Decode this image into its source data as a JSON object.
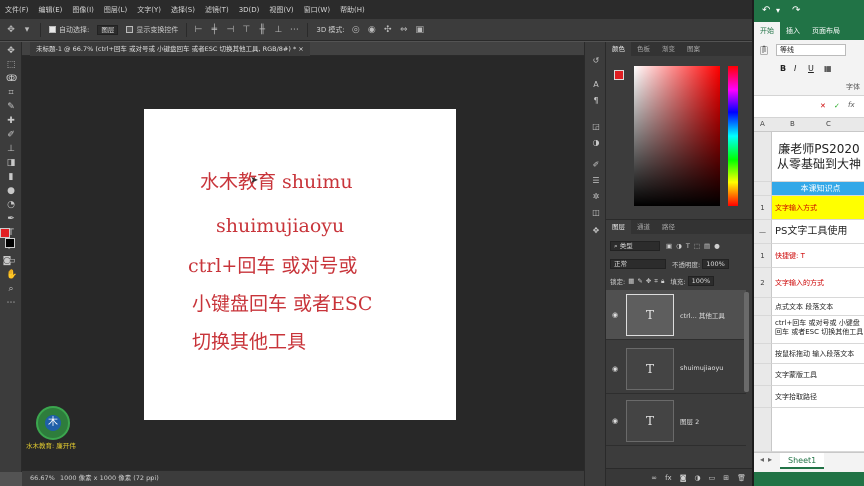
{
  "menu": [
    "文件(F)",
    "编辑(E)",
    "图像(I)",
    "图层(L)",
    "文字(Y)",
    "选择(S)",
    "滤镜(T)",
    "3D(D)",
    "视图(V)",
    "窗口(W)",
    "帮助(H)"
  ],
  "options": {
    "auto_select_label": "自动选择:",
    "auto_select_value": "图层",
    "show_transform_label": "显示变换控件",
    "mode_3d_label": "3D 模式:"
  },
  "document_tab": "未标题-1 @ 66.7% (ctrl+回车 或对号或 小键盘回车 或者ESC  切换其他工具, RGB/8#) *",
  "canvas_text": {
    "line1": "水木教育 shuimu",
    "line2": "shuimujiaoyu",
    "line3": "ctrl+回车 或对号或",
    "line4": "小键盘回车 或者ESC",
    "line5": "切换其他工具"
  },
  "watermark": {
    "logo_char": "木",
    "text": "水木教育: 廉开伟"
  },
  "status": {
    "zoom": "66.67%",
    "doc_size": "1000 像素 x 1000 像素 (72 ppi)"
  },
  "color_panel": {
    "tabs": [
      "颜色",
      "色板",
      "渐变",
      "图案"
    ],
    "foreground": "#e01e22"
  },
  "layers_panel": {
    "tabs": [
      "图层",
      "通道",
      "路径"
    ],
    "filter_label": "类型",
    "blend_mode": "正常",
    "opacity_label": "不透明度:",
    "opacity_value": "100%",
    "lock_label": "锁定:",
    "fill_label": "填充:",
    "fill_value": "100%",
    "layers": [
      {
        "name": "ctrl... 其他工具",
        "thumb": "T",
        "selected": true
      },
      {
        "name": "shuimujiaoyu",
        "thumb": "T",
        "selected": false
      },
      {
        "name": "图层 2",
        "thumb": "T",
        "selected": false
      }
    ],
    "bottom_icons": [
      "fx"
    ]
  },
  "excel": {
    "tabs": [
      "开始",
      "插入",
      "页面布局"
    ],
    "font_name": "等线",
    "font_group": "字体",
    "columns": [
      "A",
      "B",
      "C"
    ],
    "rows": [
      {
        "num": "",
        "text": "廉老师PS2020从零基础到大神"
      },
      {
        "num": "",
        "text": "本课知识点"
      },
      {
        "num": "1",
        "text": "文字输入方式"
      },
      {
        "num": "",
        "text": "PS文字工具使用"
      },
      {
        "num": "1",
        "text": "快捷键: T"
      },
      {
        "num": "2",
        "text": "文字输入的方式"
      },
      {
        "num": "",
        "text": "点式文本  段落文本"
      },
      {
        "num": "",
        "text": "ctrl+回车 或对号或 小键盘回车 或者ESC  切换其他工具"
      },
      {
        "num": "",
        "text": "按鼠标拖动 输入段落文本"
      },
      {
        "num": "",
        "text": "文字蒙版工具"
      },
      {
        "num": "",
        "text": "文字拾取路径"
      }
    ],
    "sheet": "Sheet1"
  }
}
